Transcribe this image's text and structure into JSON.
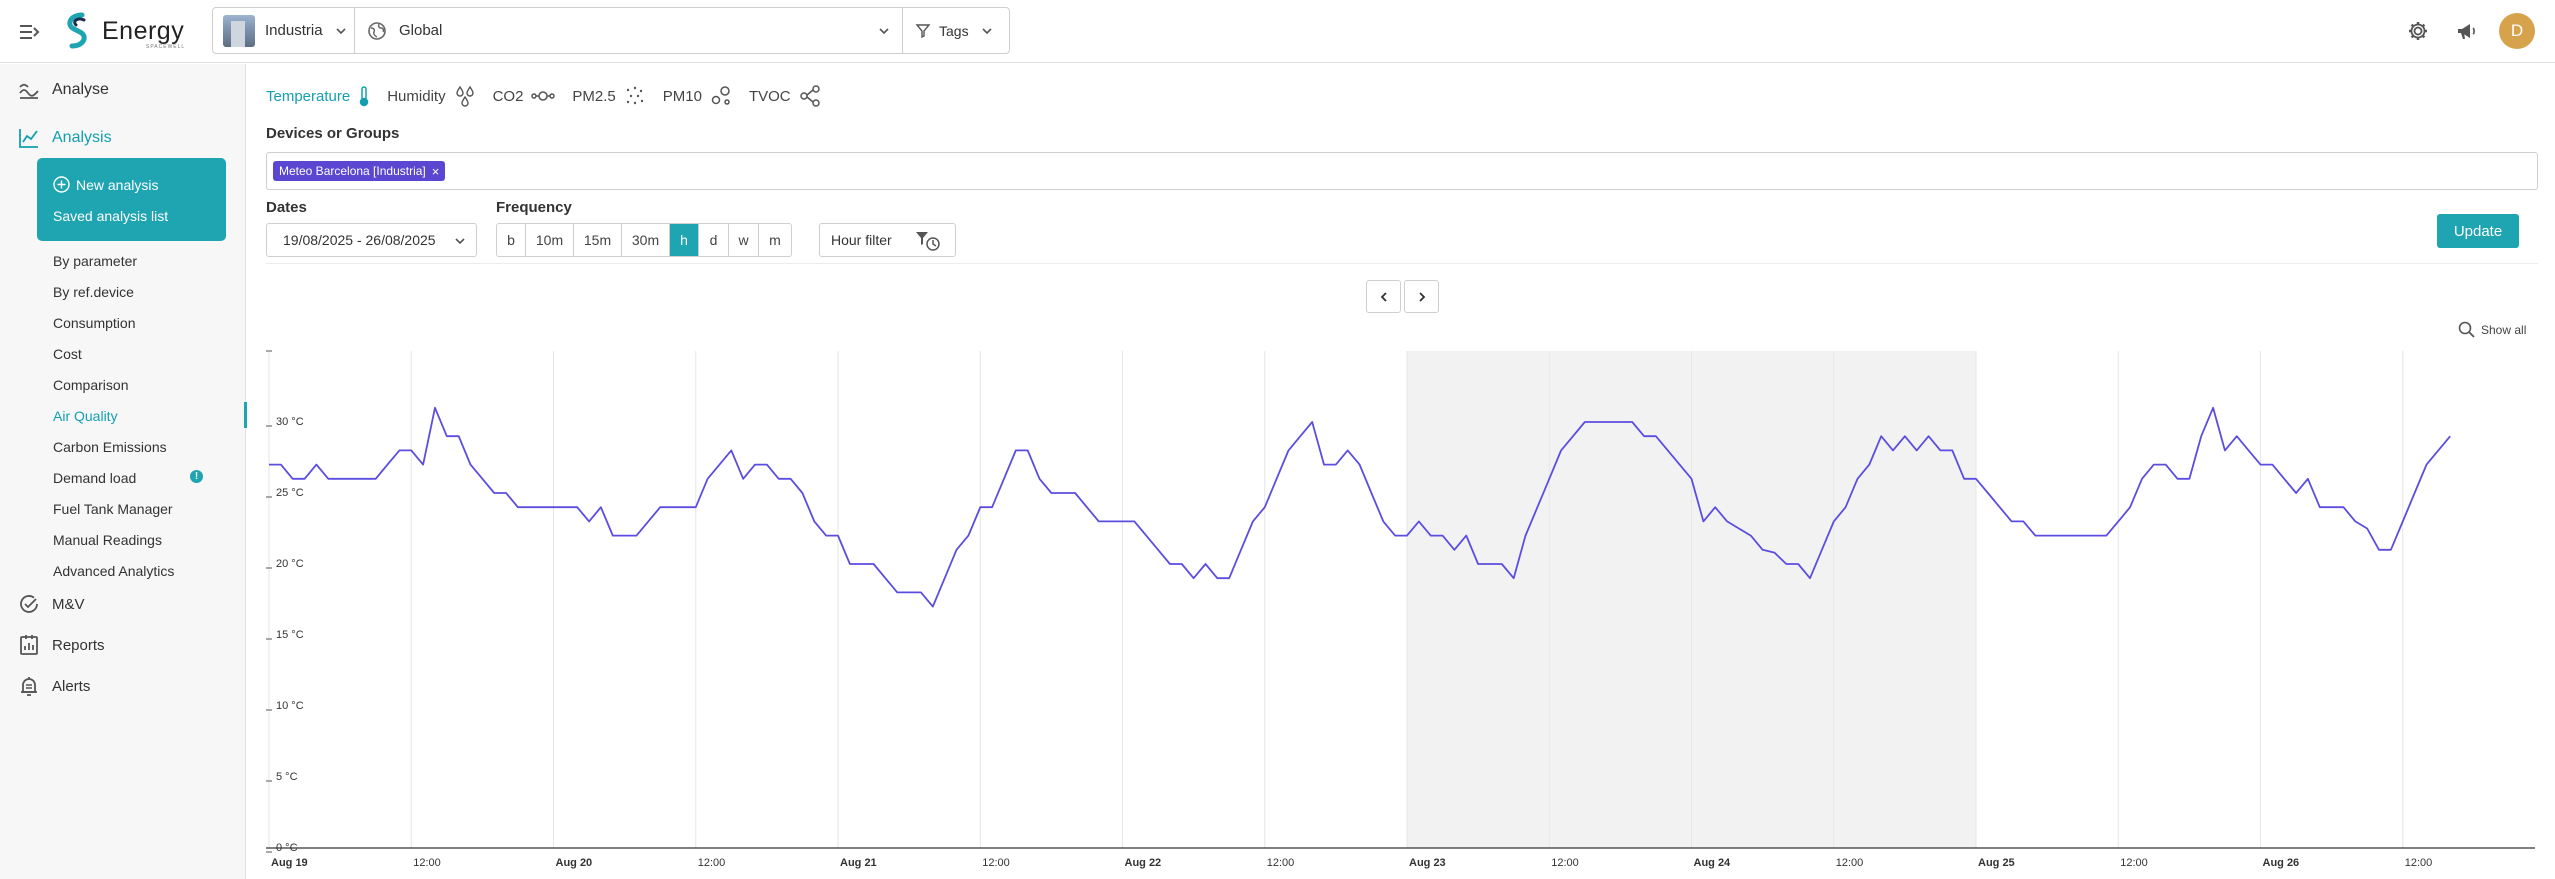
{
  "app": {
    "logo_text": "Energy",
    "logo_sub": "SPACEWELL",
    "site_selector": "Industria",
    "scope_selector": "Global",
    "tags_label": "Tags",
    "avatar_initial": "D"
  },
  "sidebar": {
    "top_items": [
      {
        "label": "Analyse",
        "icon": "analyse-icon"
      },
      {
        "label": "Analysis",
        "icon": "line-chart-icon"
      }
    ],
    "card": {
      "new_analysis": "New analysis",
      "saved_list": "Saved analysis list"
    },
    "sub_items": [
      {
        "label": "By parameter"
      },
      {
        "label": "By ref.device"
      },
      {
        "label": "Consumption"
      },
      {
        "label": "Cost"
      },
      {
        "label": "Comparison"
      },
      {
        "label": "Air Quality"
      },
      {
        "label": "Carbon Emissions"
      },
      {
        "label": "Demand load"
      },
      {
        "label": "Fuel Tank Manager"
      },
      {
        "label": "Manual Readings"
      },
      {
        "label": "Advanced Analytics"
      }
    ],
    "active_sub": "Air Quality",
    "info_badge": "!",
    "bottom_items": [
      {
        "label": "M&V",
        "icon": "check-circle-icon"
      },
      {
        "label": "Reports",
        "icon": "reports-icon"
      },
      {
        "label": "Alerts",
        "icon": "bell-icon"
      }
    ]
  },
  "main": {
    "parameter_tabs": [
      {
        "label": "Temperature",
        "icon": "thermometer-icon",
        "active": true
      },
      {
        "label": "Humidity",
        "icon": "drops-icon",
        "active": false
      },
      {
        "label": "CO2",
        "icon": "molecule-icon",
        "active": false
      },
      {
        "label": "PM2.5",
        "icon": "dots-icon",
        "active": false
      },
      {
        "label": "PM10",
        "icon": "particles-icon",
        "active": false
      },
      {
        "label": "TVOC",
        "icon": "network-icon",
        "active": false
      }
    ],
    "devices_label": "Devices or Groups",
    "device_chip": "Meteo Barcelona [Industria]",
    "chip_close": "×",
    "dates_label": "Dates",
    "date_range": "19/08/2025 - 26/08/2025",
    "frequency_label": "Frequency",
    "frequency_options": [
      "b",
      "10m",
      "15m",
      "30m",
      "h",
      "d",
      "w",
      "m"
    ],
    "frequency_active": "h",
    "hour_filter_label": "Hour filter",
    "update_button": "Update",
    "show_all": "Show all"
  },
  "chart_data": {
    "type": "line",
    "title": "",
    "xlabel": "",
    "ylabel": "",
    "unit": "°C",
    "ylim": [
      0,
      35
    ],
    "y_ticks": [
      "0 °C",
      "5 °C",
      "10 °C",
      "15 °C",
      "20 °C",
      "25 °C",
      "30 °C"
    ],
    "y_tick_values": [
      0,
      5,
      10,
      15,
      20,
      25,
      30
    ],
    "x_range": [
      "2025-08-19T00:00",
      "2025-08-26T17:00"
    ],
    "x_ticks": [
      "Aug 19",
      "12:00",
      "Aug 20",
      "12:00",
      "Aug 21",
      "12:00",
      "Aug 22",
      "12:00",
      "Aug 23",
      "12:00",
      "Aug 24",
      "12:00",
      "Aug 25",
      "12:00",
      "Aug 26",
      "12:00"
    ],
    "x_tick_bold": [
      true,
      false,
      true,
      false,
      true,
      false,
      true,
      false,
      true,
      false,
      true,
      false,
      true,
      false,
      true,
      false
    ],
    "shaded_ranges": [
      [
        "2025-08-23T00:00",
        "2025-08-25T00:00"
      ]
    ],
    "series_color": "#5b4de0",
    "series": [
      {
        "start": "2025-08-19T00:00",
        "interval_hours": 1,
        "values": [
          27,
          27,
          26,
          26,
          27,
          26,
          26,
          26,
          26,
          26,
          27,
          28,
          28,
          27,
          31,
          29,
          29,
          27,
          26,
          25,
          25,
          24,
          24,
          24,
          24,
          24,
          24,
          23,
          24,
          22,
          22,
          22,
          23,
          24,
          24,
          24,
          24,
          26,
          27,
          28,
          26,
          27,
          27,
          26,
          26,
          25,
          23,
          22,
          22,
          20,
          20,
          20,
          19,
          18,
          18,
          18,
          17,
          19,
          21,
          22,
          24,
          24,
          26,
          28,
          28,
          26,
          25,
          25,
          25,
          24,
          23,
          23,
          23,
          23,
          22,
          21,
          20,
          20,
          19,
          20,
          19,
          19,
          21,
          23,
          24,
          26,
          28,
          29,
          30,
          27,
          27,
          28,
          27,
          25,
          23,
          22,
          22,
          23,
          22,
          22,
          21,
          22,
          20,
          20,
          20,
          19,
          22,
          24,
          26,
          28,
          29,
          30,
          30,
          30,
          30,
          30,
          29,
          29,
          28,
          27,
          26,
          23,
          24,
          23,
          22.5,
          22,
          21,
          20.8,
          20,
          20,
          19,
          21,
          23,
          24,
          26,
          27,
          29,
          28,
          29,
          28,
          29,
          28,
          28,
          26,
          26,
          25,
          24,
          23,
          23,
          22,
          22,
          22,
          22,
          22,
          22,
          22,
          23,
          24,
          26,
          27,
          27,
          26,
          26,
          29,
          31,
          28,
          29,
          28,
          27,
          27,
          26,
          25,
          26,
          24,
          24,
          24,
          23,
          22.5,
          21,
          21,
          23,
          25,
          27,
          28,
          29
        ]
      }
    ]
  }
}
